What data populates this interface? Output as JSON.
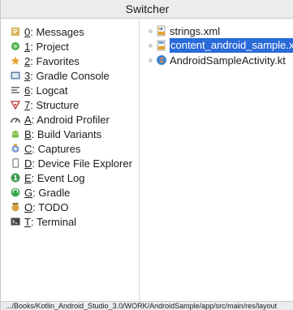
{
  "window": {
    "title": "Switcher"
  },
  "tool_windows": [
    {
      "mnemonic": "0",
      "label": ": Messages",
      "icon": "messages-icon",
      "color": "#d8b25a"
    },
    {
      "mnemonic": "1",
      "label": ": Project",
      "icon": "project-icon",
      "color": "#4cae4f"
    },
    {
      "mnemonic": "2",
      "label": ": Favorites",
      "icon": "star-icon",
      "color": "#e5a32b"
    },
    {
      "mnemonic": "3",
      "label": ": Gradle Console",
      "icon": "console-icon",
      "color": "#5b7fa8"
    },
    {
      "mnemonic": "6",
      "label": ": Logcat",
      "icon": "logcat-icon",
      "color": "#666666"
    },
    {
      "mnemonic": "7",
      "label": ": Structure",
      "icon": "structure-icon",
      "color": "#c65353"
    },
    {
      "mnemonic": "A",
      "label": ": Android Profiler",
      "icon": "profiler-icon",
      "color": "#555555"
    },
    {
      "mnemonic": "B",
      "label": ": Build Variants",
      "icon": "android-icon",
      "color": "#7cbd42"
    },
    {
      "mnemonic": "C",
      "label": ": Captures",
      "icon": "captures-icon",
      "color": "#7a9ccf"
    },
    {
      "mnemonic": "D",
      "label": ": Device File Explorer",
      "icon": "device-icon",
      "color": "#777777"
    },
    {
      "mnemonic": "E",
      "label": ": Event Log",
      "icon": "event-log-icon",
      "color": "#3e9a4d"
    },
    {
      "mnemonic": "G",
      "label": ": Gradle",
      "icon": "gradle-icon",
      "color": "#36a547"
    },
    {
      "mnemonic": "O",
      "label": ": TODO",
      "icon": "todo-icon",
      "color": "#d4a24a"
    },
    {
      "mnemonic": "T",
      "label": ": Terminal",
      "icon": "terminal-icon",
      "color": "#444444"
    }
  ],
  "files": [
    {
      "name": "strings.xml",
      "icon": "xml-file-icon",
      "selected": false
    },
    {
      "name": "content_android_sample.xml",
      "icon": "layout-file-icon",
      "selected": true
    },
    {
      "name": "AndroidSampleActivity.kt",
      "icon": "kotlin-file-icon",
      "selected": false
    }
  ],
  "status_bar": {
    "path": ".../Books/Kotlin_Android_Studio_3.0/WORK/AndroidSample/app/src/main/res/layout"
  },
  "colors": {
    "selection": "#2a6ad9",
    "title_bar_bg": "#ececec"
  }
}
